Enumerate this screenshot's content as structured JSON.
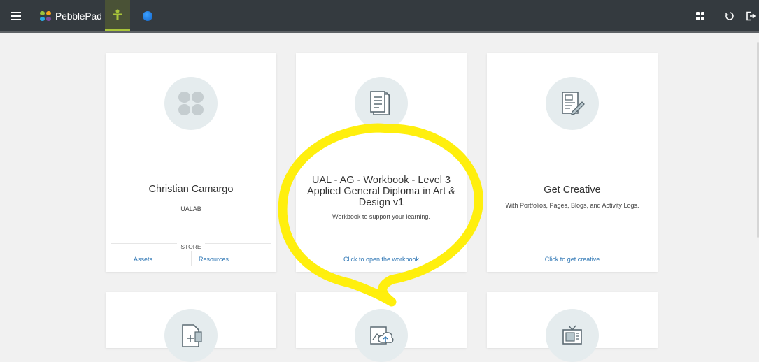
{
  "app": {
    "name": "PebblePad"
  },
  "colors": {
    "topbar": "#343a3f",
    "accent_green": "#a9c53a",
    "link": "#2f77b5",
    "highlight": "#ffee00"
  },
  "header": {
    "icons": [
      "menu-icon",
      "pebblepad-logo-icon",
      "person-icon",
      "globe-icon",
      "tiles-icon",
      "history-icon",
      "logout-icon"
    ]
  },
  "cards": [
    {
      "title": "Christian Camargo",
      "subtitle": "UALAB",
      "store_label": "STORE",
      "links": [
        "Assets",
        "Resources"
      ],
      "icon": "clover-icon"
    },
    {
      "title": "UAL - AG - Workbook - Level 3 Applied General Diploma in Art & Design v1",
      "subtitle": "Workbook to support your learning.",
      "link": "Click to open the workbook",
      "icon": "workbook-icon"
    },
    {
      "title": "Get Creative",
      "subtitle": "With Portfolios, Pages, Blogs, and Activity Logs.",
      "link": "Click to get creative",
      "icon": "edit-document-icon"
    },
    {
      "icon": "add-document-icon"
    },
    {
      "icon": "upload-image-icon"
    },
    {
      "icon": "tv-icon"
    }
  ]
}
